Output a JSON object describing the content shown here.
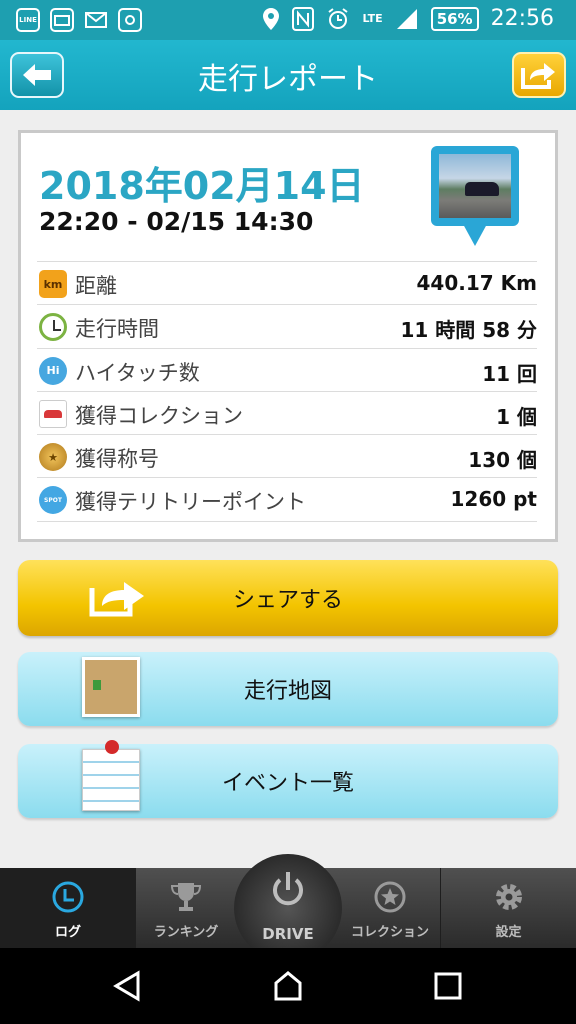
{
  "status_bar": {
    "icons": [
      "LINE",
      "Bookwalker",
      "mail-icon",
      "instagram-icon",
      "location-icon",
      "nfc-icon",
      "alarm-icon",
      "signal-icon"
    ],
    "network": "LTE",
    "battery": "56%",
    "time": "22:56"
  },
  "header": {
    "title": "走行レポート",
    "back_icon": "arrow-left-icon",
    "share_icon": "share-arrow-icon"
  },
  "report": {
    "date": "2018年02月14日",
    "time_range": "22:20 - 02/15 14:30",
    "rows": [
      {
        "icon": "km-icon",
        "icon_text": "km",
        "label": "距離",
        "value": "440.17 Km"
      },
      {
        "icon": "clock-icon",
        "icon_text": "",
        "label": "走行時間",
        "value": "11 時間 58 分"
      },
      {
        "icon": "hi-touch-icon",
        "icon_text": "Hi",
        "label": "ハイタッチ数",
        "value": "11 回"
      },
      {
        "icon": "car-icon",
        "icon_text": "",
        "label": "獲得コレクション",
        "value": "1 個"
      },
      {
        "icon": "medal-icon",
        "icon_text": "★",
        "label": "獲得称号",
        "value": "130 個"
      },
      {
        "icon": "spot-icon",
        "icon_text": "SPOT",
        "label": "獲得テリトリーポイント",
        "value": "1260 pt"
      }
    ]
  },
  "actions": {
    "share_label": "シェアする",
    "map_label": "走行地図",
    "events_label": "イベント一覧"
  },
  "bottom_nav": {
    "log": "ログ",
    "ranking": "ランキング",
    "drive": "DRIVE",
    "collection": "コレクション",
    "settings": "設定"
  },
  "colors": {
    "header": "#1aa9c2",
    "date": "#2ba6c4",
    "share_button": "#f3c400",
    "nav_button": "#8bdcee",
    "bottom_nav": "#3a3a3a"
  }
}
